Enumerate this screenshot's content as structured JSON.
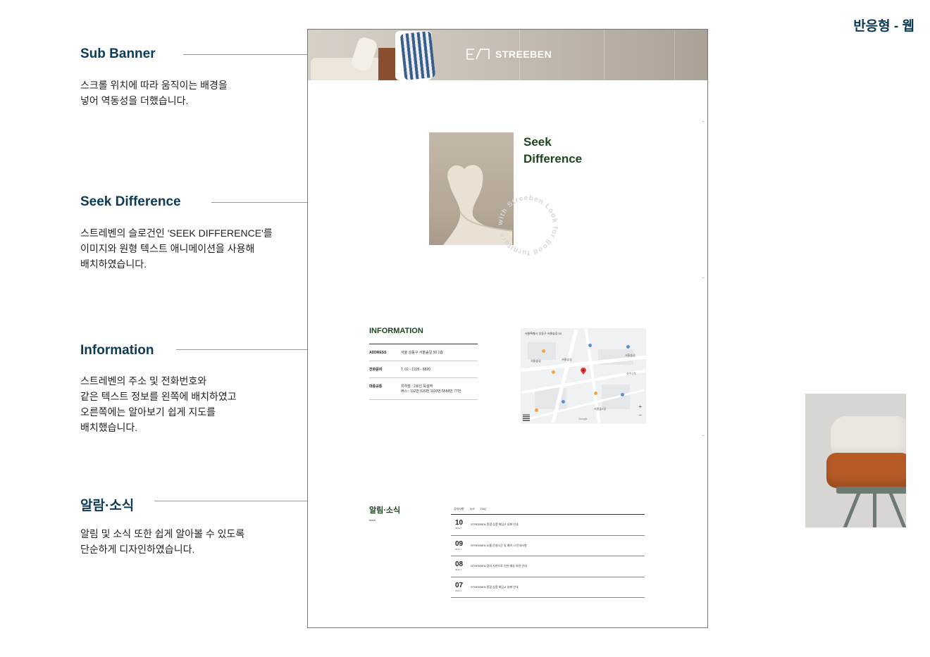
{
  "tag": "반응형 - 웹",
  "annotations": [
    {
      "title": "Sub Banner",
      "desc": "스크롤 위치에 따라 움직이는 배경을\n넣어 역동성을 더했습니다."
    },
    {
      "title": "Seek Difference",
      "desc": "스트레벤의 슬로건인 'SEEK DIFFERENCE'를\n이미지와 원형 텍스트 애니메이션을 사용해\n배치하였습니다."
    },
    {
      "title": "Information",
      "desc": "스트레벤의 주소 및 전화번호와\n같은 텍스트 정보를 왼쪽에 배치하였고\n오른쪽에는 알아보기 쉽게 지도를\n배치했습니다."
    },
    {
      "title": "알람·소식",
      "desc": "알림 및 소식 또한 쉽게 알아볼 수 있도록\n단순하게 디자인하였습니다."
    }
  ],
  "site": {
    "logo_text": "STREEBEN",
    "seek": {
      "title_line1": "Seek",
      "title_line2": "Difference",
      "circle_text": "with Streeben Look for good furniture"
    },
    "information": {
      "title": "INFORMATION",
      "rows": [
        {
          "label": "ADDRESS",
          "value": "서울 성동구 서울숲길 50 1층"
        },
        {
          "label": "전화문의",
          "value": "T. 02 - 1225 - 8820"
        },
        {
          "label": "대중교통",
          "value": "지하철 : 2호선 뚝섬역\n버스 : 112번 520번 1110번 5558번 77번"
        }
      ],
      "map": {
        "address": "서울특별시 성동구 서울숲길 50",
        "labels": [
          "서울숲길",
          "서울숲길",
          "서울숲길",
          "서울숲2길",
          "성수1가"
        ],
        "google": "Google",
        "zoom_in": "+",
        "zoom_out": "−"
      }
    },
    "news": {
      "title": "알림·소식",
      "more": "more",
      "tabs": [
        "공지사항",
        "뉴스",
        "FAQ"
      ],
      "items": [
        {
          "day": "10",
          "ym": "2024.7",
          "text": "STREEBEN 종합 상품 재입고 날짜 안내"
        },
        {
          "day": "09",
          "ym": "2024.7",
          "text": "STREEBEN 쇼룸 운영시간 및 예약 시 안내사항"
        },
        {
          "day": "08",
          "ym": "2024.7",
          "text": "STREEBEN 장마 지연으로 인한 배송 지연 안내"
        },
        {
          "day": "07",
          "ym": "2024.7",
          "text": "STREEBEN 종합 상품 재입고 날짜 안내"
        }
      ]
    }
  },
  "colors": {
    "annotation_title": "#0d3a56",
    "site_green": "#1e4521"
  }
}
